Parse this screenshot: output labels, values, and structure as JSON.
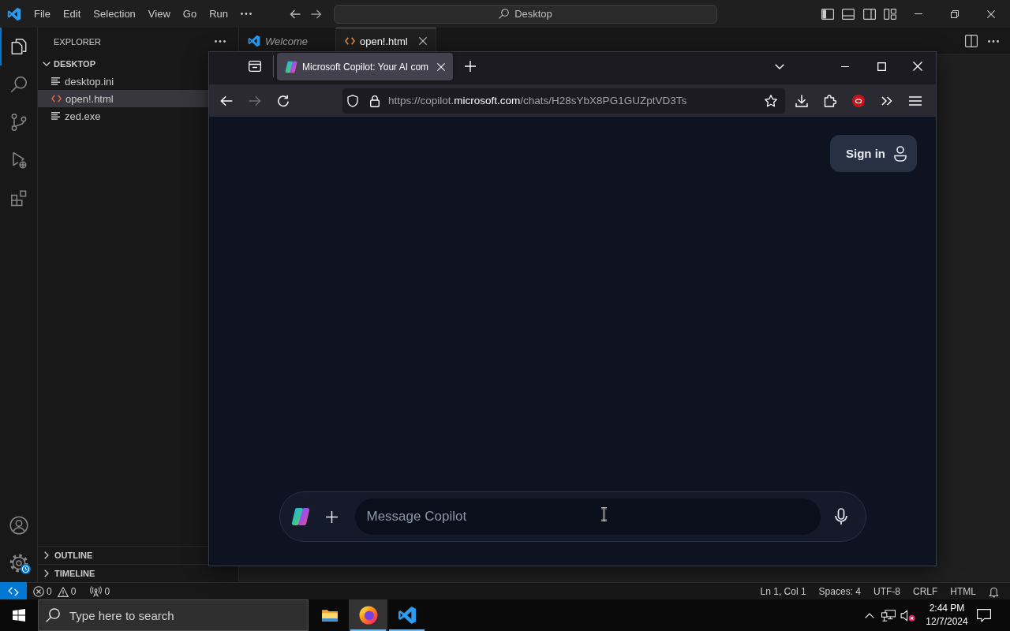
{
  "vscode": {
    "menu": [
      "File",
      "Edit",
      "Selection",
      "View",
      "Go",
      "Run"
    ],
    "command_center": {
      "label": "Desktop"
    },
    "activity_bar": [
      {
        "kind": "explorer",
        "selected": true
      },
      {
        "kind": "search",
        "selected": false
      },
      {
        "kind": "source-control",
        "selected": false
      },
      {
        "kind": "run-debug",
        "selected": false
      },
      {
        "kind": "extensions",
        "selected": false
      }
    ],
    "activity_bar_bottom": [
      {
        "kind": "accounts",
        "update_badge": false
      },
      {
        "kind": "settings",
        "update_badge": true
      }
    ],
    "sidebar": {
      "title": "EXPLORER",
      "folder": {
        "name": "DESKTOP",
        "expanded": true,
        "children": [
          {
            "name": "desktop.ini",
            "kind": "text",
            "selected": false
          },
          {
            "name": "open!.html",
            "kind": "html",
            "selected": true
          },
          {
            "name": "zed.exe",
            "kind": "text",
            "selected": false
          }
        ]
      },
      "sections": [
        {
          "name": "OUTLINE",
          "expanded": false
        },
        {
          "name": "TIMELINE",
          "expanded": false
        }
      ]
    },
    "editor_tabs": [
      {
        "label": "Welcome",
        "kind": "welcome",
        "preview": true,
        "selected": false
      },
      {
        "label": "open!.html",
        "kind": "html",
        "preview": false,
        "selected": true
      }
    ],
    "status_bar": {
      "errors": "0",
      "warnings": "0",
      "ports": "0",
      "items": [
        "Ln 1, Col 1",
        "Spaces: 4",
        "UTF-8",
        "CRLF",
        "HTML"
      ]
    }
  },
  "browser": {
    "tabs": [
      {
        "title": "Microsoft Copilot: Your AI com",
        "selected": true
      }
    ],
    "nav": [
      {
        "kind": "back",
        "disabled": false
      },
      {
        "kind": "forward",
        "disabled": true
      },
      {
        "kind": "reload",
        "disabled": false
      }
    ],
    "url_parts": [
      {
        "text": "https://copilot.",
        "highlight": false
      },
      {
        "text": "microsoft.com",
        "highlight": true
      },
      {
        "text": "/chats/H28sYbX8PG1GUZptVD3Ts",
        "highlight": false
      }
    ],
    "page": {
      "sign_in": "Sign in",
      "composer": {
        "placeholder": "Message Copilot"
      }
    }
  },
  "taskbar": {
    "search": {
      "placeholder": "Type here to search"
    },
    "apps": [
      {
        "kind": "file-explorer",
        "running": false,
        "selected": false
      },
      {
        "kind": "firefox",
        "running": true,
        "selected": true
      },
      {
        "kind": "vscode",
        "running": true,
        "selected": false
      }
    ],
    "tray": {
      "volume_muted": true
    },
    "time": "2:44 PM",
    "date": "12/7/2024"
  }
}
